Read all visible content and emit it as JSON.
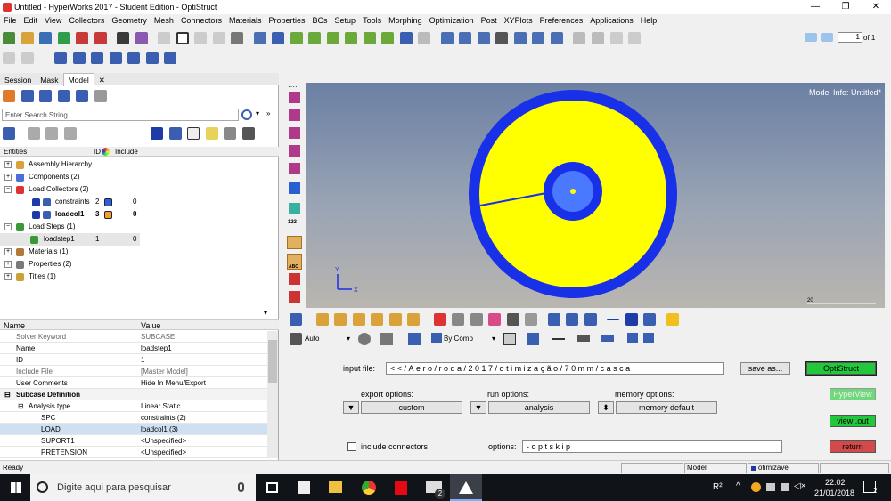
{
  "window": {
    "title": "Untitled - HyperWorks 2017 - Student Edition - OptiStruct",
    "minimize": "—",
    "restore": "❐",
    "close": "✕"
  },
  "menu": [
    "File",
    "Edit",
    "View",
    "Collectors",
    "Geometry",
    "Mesh",
    "Connectors",
    "Materials",
    "Properties",
    "BCs",
    "Setup",
    "Tools",
    "Morphing",
    "Optimization",
    "Post",
    "XYPlots",
    "Preferences",
    "Applications",
    "Help"
  ],
  "toolbar": {
    "page_value": "1",
    "page_of": "of 1"
  },
  "tabs": [
    "Session",
    "Mask",
    "Model"
  ],
  "search": {
    "placeholder": "Enter Search String..."
  },
  "tree_header": {
    "entities": "Entities",
    "id": "ID",
    "include": "Include"
  },
  "tree": [
    {
      "label": "Assembly Hierarchy",
      "id": "",
      "inc": "",
      "exp": "+"
    },
    {
      "label": "Components (2)",
      "id": "",
      "inc": "",
      "exp": "+"
    },
    {
      "label": "Load Collectors (2)",
      "id": "",
      "inc": "",
      "exp": "−"
    },
    {
      "label": "constraints",
      "id": "2",
      "inc": "0",
      "exp": ""
    },
    {
      "label": "loadcol1",
      "id": "3",
      "inc": "0",
      "exp": ""
    },
    {
      "label": "Load Steps (1)",
      "id": "",
      "inc": "",
      "exp": "−"
    },
    {
      "label": "loadstep1",
      "id": "1",
      "inc": "0",
      "exp": ""
    },
    {
      "label": "Materials (1)",
      "id": "",
      "inc": "",
      "exp": "+"
    },
    {
      "label": "Properties (2)",
      "id": "",
      "inc": "",
      "exp": "+"
    },
    {
      "label": "Titles (1)",
      "id": "",
      "inc": "",
      "exp": "+"
    }
  ],
  "props_header": {
    "name": "Name",
    "value": "Value"
  },
  "props": [
    {
      "k": "Solver Keyword",
      "v": "SUBCASE"
    },
    {
      "k": "Name",
      "v": "loadstep1"
    },
    {
      "k": "ID",
      "v": "1"
    },
    {
      "k": "Include File",
      "v": "[Master Model]"
    },
    {
      "k": "User Comments",
      "v": "Hide In Menu/Export"
    },
    {
      "k": "Subcase Definition",
      "v": ""
    },
    {
      "k": "Analysis type",
      "v": "Linear Static"
    },
    {
      "k": "SPC",
      "v": "constraints (2)"
    },
    {
      "k": "LOAD",
      "v": "loadcol1 (3)"
    },
    {
      "k": "SUPORT1",
      "v": "<Unspecified>"
    },
    {
      "k": "PRETENSION",
      "v": "<Unspecified>"
    }
  ],
  "viewport": {
    "model_info": "Model Info: Untitled*",
    "scale": "20"
  },
  "vtool_label": "123",
  "vtool_label2": "ABC",
  "lower_toolbar": {
    "auto": "Auto",
    "bycomp": "By Comp"
  },
  "panel": {
    "input_file_label": "input file:",
    "input_file_value": "<</Aero/roda/2017/otimização/70mm/casca",
    "save_as": "save as...",
    "optistruct": "OptiStruct",
    "hyperview": "HyperView",
    "view_out": "view .out",
    "return": "return",
    "export_label": "export options:",
    "export_value": "custom",
    "run_label": "run options:",
    "run_value": "analysis",
    "memory_label": "memory options:",
    "memory_value": "memory default",
    "include_connectors": "include connectors",
    "options_label": "options:",
    "options_value": "-optskip"
  },
  "status": {
    "ready": "Ready",
    "model": "Model",
    "collector": "otimizavel"
  },
  "taskbar": {
    "search": "Digite aqui para pesquisar",
    "time": "22:02",
    "date": "21/01/2018",
    "notif": "2"
  },
  "colors": {
    "accent_green": "#22c83c",
    "return_red": "#d14b4b",
    "ring_blue": "#1830e8",
    "fill_yellow": "#ffff00"
  }
}
